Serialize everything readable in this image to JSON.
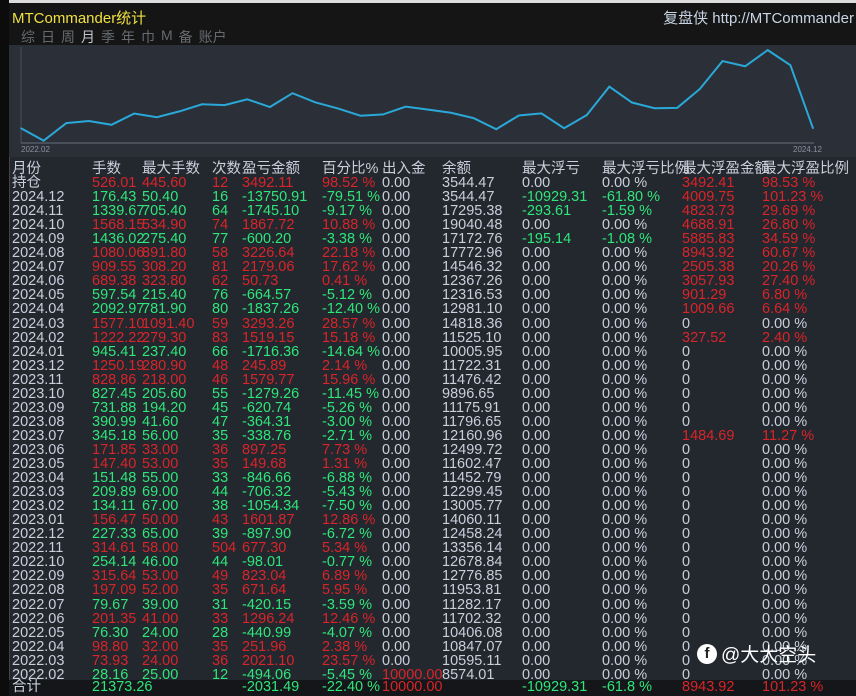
{
  "header": {
    "title": "MTCommander统计",
    "brand": "复盘侠 http://MTCommander",
    "tabs": [
      "综",
      "日",
      "周",
      "月",
      "季",
      "年",
      "巾",
      "M",
      "备",
      "账户"
    ],
    "active_tab": "月"
  },
  "chart_data": {
    "type": "line",
    "title": "",
    "xlabel": "",
    "ylabel": "",
    "x_start_label": "2022.02",
    "x_end_label": "2024.12",
    "ylim": [
      8300,
      19400
    ],
    "series": [
      {
        "name": "余额",
        "values": [
          10000,
          8574.01,
          10595.11,
          10847.07,
          10406.08,
          11702.32,
          11282.17,
          11953.81,
          12776.85,
          12678.84,
          13356.14,
          12458.24,
          14060.11,
          13005.77,
          12299.45,
          11452.79,
          11602.47,
          12499.72,
          12160.96,
          11796.65,
          11175.91,
          9896.65,
          11476.42,
          11722.31,
          10005.95,
          11525.1,
          14818.36,
          12981.1,
          12316.53,
          12367.26,
          14546.32,
          17772.96,
          17172.76,
          19040.48,
          17295.38,
          10000
        ]
      }
    ],
    "color": "#2aa8d8"
  },
  "table": {
    "columns": [
      "月份",
      "手数",
      "最大手数",
      "次数",
      "盈亏金额",
      "百分比%",
      "出入金",
      "余额",
      "最大浮亏",
      "最大浮亏比例",
      "最大浮盈金额",
      "最大浮盈比例"
    ],
    "rows": [
      [
        "持仓",
        "526.01",
        "445.60",
        "12",
        "3492.11",
        "98.52 %",
        "0.00",
        "3544.47",
        "0.00",
        "0.00 %",
        "3492.41",
        "98.53 %",
        "up"
      ],
      [
        "2024.12",
        "176.43",
        "50.40",
        "16",
        "-13750.91",
        "-79.51 %",
        "0.00",
        "3544.47",
        "-10929.31",
        "-61.80 %",
        "4009.75",
        "101.23 %",
        "dn"
      ],
      [
        "2024.11",
        "1339.67",
        "705.40",
        "64",
        "-1745.10",
        "-9.17 %",
        "0.00",
        "17295.38",
        "-293.61",
        "-1.59 %",
        "4823.73",
        "29.69 %",
        "dn"
      ],
      [
        "2024.10",
        "1568.15",
        "534.90",
        "74",
        "1867.72",
        "10.88 %",
        "0.00",
        "19040.48",
        "0.00",
        "0.00 %",
        "4688.91",
        "26.80 %",
        "up"
      ],
      [
        "2024.09",
        "1436.02",
        "275.40",
        "77",
        "-600.20",
        "-3.38 %",
        "0.00",
        "17172.76",
        "-195.14",
        "-1.08 %",
        "5885.83",
        "34.59 %",
        "dn"
      ],
      [
        "2024.08",
        "1080.06",
        "891.80",
        "58",
        "3226.64",
        "22.18 %",
        "0.00",
        "17772.96",
        "0.00",
        "0.00 %",
        "8943.92",
        "60.67 %",
        "up"
      ],
      [
        "2024.07",
        "909.55",
        "308.20",
        "81",
        "2179.06",
        "17.62 %",
        "0.00",
        "14546.32",
        "0.00",
        "0.00 %",
        "2505.38",
        "20.26 %",
        "up"
      ],
      [
        "2024.06",
        "689.38",
        "323.80",
        "62",
        "50.73",
        "0.41 %",
        "0.00",
        "12367.26",
        "0.00",
        "0.00 %",
        "3057.93",
        "27.40 %",
        "up"
      ],
      [
        "2024.05",
        "597.54",
        "215.40",
        "76",
        "-664.57",
        "-5.12 %",
        "0.00",
        "12316.53",
        "0.00",
        "0.00 %",
        "901.29",
        "6.80 %",
        "dn"
      ],
      [
        "2024.04",
        "2092.97",
        "781.90",
        "80",
        "-1837.26",
        "-12.40 %",
        "0.00",
        "12981.10",
        "0.00",
        "0.00 %",
        "1009.66",
        "6.64 %",
        "dn"
      ],
      [
        "2024.03",
        "1577.10",
        "1091.40",
        "59",
        "3293.26",
        "28.57 %",
        "0.00",
        "14818.36",
        "0.00",
        "0.00 %",
        "0",
        "0.00 %",
        "up"
      ],
      [
        "2024.02",
        "1222.22",
        "279.30",
        "83",
        "1519.15",
        "15.18 %",
        "0.00",
        "11525.10",
        "0.00",
        "0.00 %",
        "327.52",
        "2.40 %",
        "up"
      ],
      [
        "2024.01",
        "945.41",
        "237.40",
        "66",
        "-1716.36",
        "-14.64 %",
        "0.00",
        "10005.95",
        "0.00",
        "0.00 %",
        "0",
        "0.00 %",
        "dn"
      ],
      [
        "2023.12",
        "1250.19",
        "280.90",
        "48",
        "245.89",
        "2.14 %",
        "0.00",
        "11722.31",
        "0.00",
        "0.00 %",
        "0",
        "0.00 %",
        "up"
      ],
      [
        "2023.11",
        "828.86",
        "218.00",
        "46",
        "1579.77",
        "15.96 %",
        "0.00",
        "11476.42",
        "0.00",
        "0.00 %",
        "0",
        "0.00 %",
        "up"
      ],
      [
        "2023.10",
        "827.45",
        "205.60",
        "55",
        "-1279.26",
        "-11.45 %",
        "0.00",
        "9896.65",
        "0.00",
        "0.00 %",
        "0",
        "0.00 %",
        "dn"
      ],
      [
        "2023.09",
        "731.88",
        "194.20",
        "45",
        "-620.74",
        "-5.26 %",
        "0.00",
        "11175.91",
        "0.00",
        "0.00 %",
        "0",
        "0.00 %",
        "dn"
      ],
      [
        "2023.08",
        "390.99",
        "41.60",
        "47",
        "-364.31",
        "-3.00 %",
        "0.00",
        "11796.65",
        "0.00",
        "0.00 %",
        "0",
        "0.00 %",
        "dn"
      ],
      [
        "2023.07",
        "345.18",
        "56.00",
        "35",
        "-338.76",
        "-2.71 %",
        "0.00",
        "12160.96",
        "0.00",
        "0.00 %",
        "1484.69",
        "11.27 %",
        "dn"
      ],
      [
        "2023.06",
        "171.85",
        "33.00",
        "36",
        "897.25",
        "7.73 %",
        "0.00",
        "12499.72",
        "0.00",
        "0.00 %",
        "0",
        "0.00 %",
        "up"
      ],
      [
        "2023.05",
        "147.40",
        "53.00",
        "35",
        "149.68",
        "1.31 %",
        "0.00",
        "11602.47",
        "0.00",
        "0.00 %",
        "0",
        "0.00 %",
        "up"
      ],
      [
        "2023.04",
        "151.48",
        "55.00",
        "33",
        "-846.66",
        "-6.88 %",
        "0.00",
        "11452.79",
        "0.00",
        "0.00 %",
        "0",
        "0.00 %",
        "dn"
      ],
      [
        "2023.03",
        "209.89",
        "69.00",
        "44",
        "-706.32",
        "-5.43 %",
        "0.00",
        "12299.45",
        "0.00",
        "0.00 %",
        "0",
        "0.00 %",
        "dn"
      ],
      [
        "2023.02",
        "134.11",
        "67.00",
        "38",
        "-1054.34",
        "-7.50 %",
        "0.00",
        "13005.77",
        "0.00",
        "0.00 %",
        "0",
        "0.00 %",
        "dn"
      ],
      [
        "2023.01",
        "156.47",
        "50.00",
        "43",
        "1601.87",
        "12.86 %",
        "0.00",
        "14060.11",
        "0.00",
        "0.00 %",
        "0",
        "0.00 %",
        "up"
      ],
      [
        "2022.12",
        "227.33",
        "65.00",
        "39",
        "-897.90",
        "-6.72 %",
        "0.00",
        "12458.24",
        "0.00",
        "0.00 %",
        "0",
        "0.00 %",
        "dn"
      ],
      [
        "2022.11",
        "314.61",
        "58.00",
        "504",
        "677.30",
        "5.34 %",
        "0.00",
        "13356.14",
        "0.00",
        "0.00 %",
        "0",
        "0.00 %",
        "up"
      ],
      [
        "2022.10",
        "254.14",
        "46.00",
        "44",
        "-98.01",
        "-0.77 %",
        "0.00",
        "12678.84",
        "0.00",
        "0.00 %",
        "0",
        "0.00 %",
        "dn"
      ],
      [
        "2022.09",
        "315.64",
        "53.00",
        "49",
        "823.04",
        "6.89 %",
        "0.00",
        "12776.85",
        "0.00",
        "0.00 %",
        "0",
        "0.00 %",
        "up"
      ],
      [
        "2022.08",
        "197.09",
        "52.00",
        "35",
        "671.64",
        "5.95 %",
        "0.00",
        "11953.81",
        "0.00",
        "0.00 %",
        "0",
        "0.00 %",
        "up"
      ],
      [
        "2022.07",
        "79.67",
        "39.00",
        "31",
        "-420.15",
        "-3.59 %",
        "0.00",
        "11282.17",
        "0.00",
        "0.00 %",
        "0",
        "0.00 %",
        "dn"
      ],
      [
        "2022.06",
        "201.35",
        "41.00",
        "33",
        "1296.24",
        "12.46 %",
        "0.00",
        "11702.32",
        "0.00",
        "0.00 %",
        "0",
        "0.00 %",
        "up"
      ],
      [
        "2022.05",
        "76.30",
        "24.00",
        "28",
        "-440.99",
        "-4.07 %",
        "0.00",
        "10406.08",
        "0.00",
        "0.00 %",
        "0",
        "0.00 %",
        "dn"
      ],
      [
        "2022.04",
        "98.80",
        "32.00",
        "35",
        "251.96",
        "2.38 %",
        "0.00",
        "10847.07",
        "0.00",
        "0.00 %",
        "0",
        "0.00 %",
        "up"
      ],
      [
        "2022.03",
        "73.93",
        "24.00",
        "36",
        "2021.10",
        "23.57 %",
        "0.00",
        "10595.11",
        "0.00",
        "0.00 %",
        "0",
        "0.00 %",
        "up"
      ],
      [
        "2022.02",
        "28.16",
        "25.00",
        "12",
        "-494.06",
        "-5.45 %",
        "10000.00",
        "8574.01",
        "0.00",
        "0.00 %",
        "0",
        "0.00 %",
        "dn"
      ]
    ],
    "total": [
      "合计",
      "21373.26",
      "",
      "",
      "-2031.49",
      "-22.40 %",
      "10000.00",
      "",
      "-10929.31",
      "-61.8 %",
      "8943.92",
      "101.23 %"
    ]
  },
  "watermark": "@大大空头",
  "colors": {
    "up": "#d8252a",
    "down": "#2ee67a",
    "neutral": "#c8d0dc",
    "title": "#f0e040"
  }
}
